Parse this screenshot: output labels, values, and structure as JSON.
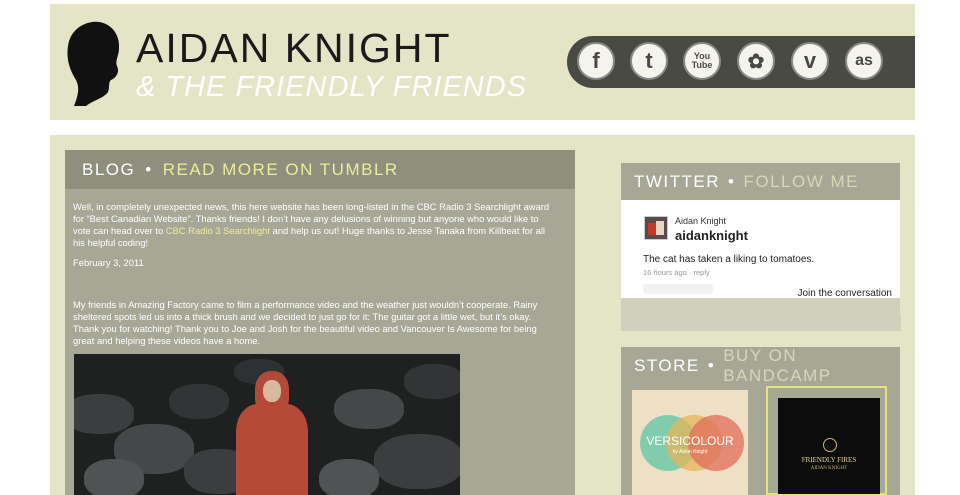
{
  "header": {
    "title": "AIDAN KNIGHT",
    "subtitle": "& THE FRIENDLY FRIENDS",
    "social": [
      {
        "name": "facebook",
        "glyph": "f"
      },
      {
        "name": "twitter",
        "glyph": "t"
      },
      {
        "name": "youtube",
        "glyph": "You Tube"
      },
      {
        "name": "flower",
        "glyph": "✿"
      },
      {
        "name": "vimeo",
        "glyph": "v"
      },
      {
        "name": "lastfm",
        "glyph": "as"
      }
    ]
  },
  "blog": {
    "heading": "BLOG",
    "separator": "•",
    "read_more": "READ MORE ON TUMBLR",
    "post1_part1": "Well, in completely unexpected news, this here website has been long-listed in the CBC Radio 3 Searchlight award for “Best Canadian Website”. Thanks friends! I don’t have any delusions of winning but anyone who would like to vote can head over to ",
    "post1_link": "CBC Radio 3 Searchlight",
    "post1_part2": " and help us out! Huge thanks to Jesse Tanaka from Killbeat for all his helpful coding!",
    "post1_date": "February 3, 2011",
    "post2": "My friends in Amazing Factory came to film a performance video and the weather just wouldn’t cooperate. Rainy sheltered spots led us into a thick brush and we decided to just go for it: The guitar got a little wet, but it’s okay. Thank you for watching! Thank you to Joe and Josh for the beautiful video and Vancouver Is Awesome for being great and helping these videos have a home."
  },
  "twitter": {
    "heading": "TWITTER",
    "separator": "•",
    "follow": "FOLLOW ME",
    "name": "Aidan Knight",
    "handle": "aidanknight",
    "tweet": "The cat has taken a liking to tomatoes.",
    "time": "16 hours ago",
    "dot": "·",
    "reply": "reply",
    "join": "Join the conversation"
  },
  "store": {
    "heading": "STORE",
    "separator": "•",
    "buy": "BUY ON BANDCAMP",
    "album1_title": "VERSICOLOUR",
    "album1_artist": "by Aidan Knight",
    "album2_title": "FRIENDLY FIRES",
    "album2_artist": "AIDAN KNIGHT"
  },
  "colors": {
    "panel": "#e4e4c6",
    "accent": "#ecec9a",
    "olive": "#a7a796",
    "dark": "#4a4a44"
  }
}
